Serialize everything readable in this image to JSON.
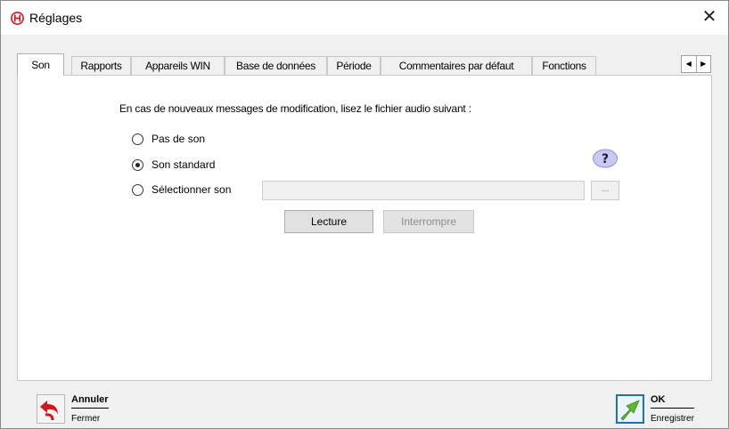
{
  "window": {
    "title": "Réglages",
    "close_glyph": "✕"
  },
  "tabs": [
    {
      "label": "Son",
      "active": true
    },
    {
      "label": "Rapports"
    },
    {
      "label": "Appareils WIN"
    },
    {
      "label": "Base de données"
    },
    {
      "label": "Période"
    },
    {
      "label": "Commentaires par défaut"
    },
    {
      "label": "Fonctions"
    }
  ],
  "tab_scroll": {
    "left": "◀",
    "right": "▶"
  },
  "sound": {
    "instruction": "En cas de nouveaux messages de modification, lisez le fichier audio suivant :",
    "options": [
      {
        "label": "Pas de son",
        "checked": false
      },
      {
        "label": "Son standard",
        "checked": true
      },
      {
        "label": "Sélectionner son",
        "checked": false
      }
    ],
    "file_value": "",
    "browse_label": "...",
    "play_label": "Lecture",
    "stop_label": "Interrompre"
  },
  "footer": {
    "cancel": {
      "title": "Annuler",
      "subtitle": "Fermer"
    },
    "ok": {
      "title": "OK",
      "subtitle": "Enregistrer"
    }
  },
  "icons": {
    "app": "app-logo-icon",
    "help": "help-question-icon",
    "cancel": "undo-arrow-icon",
    "ok": "save-arrow-icon"
  },
  "colors": {
    "accent_red": "#d0161b",
    "ok_green": "#5cb82e",
    "ok_frame": "#1f6fb5",
    "help_purple": "#a6a6e8"
  }
}
